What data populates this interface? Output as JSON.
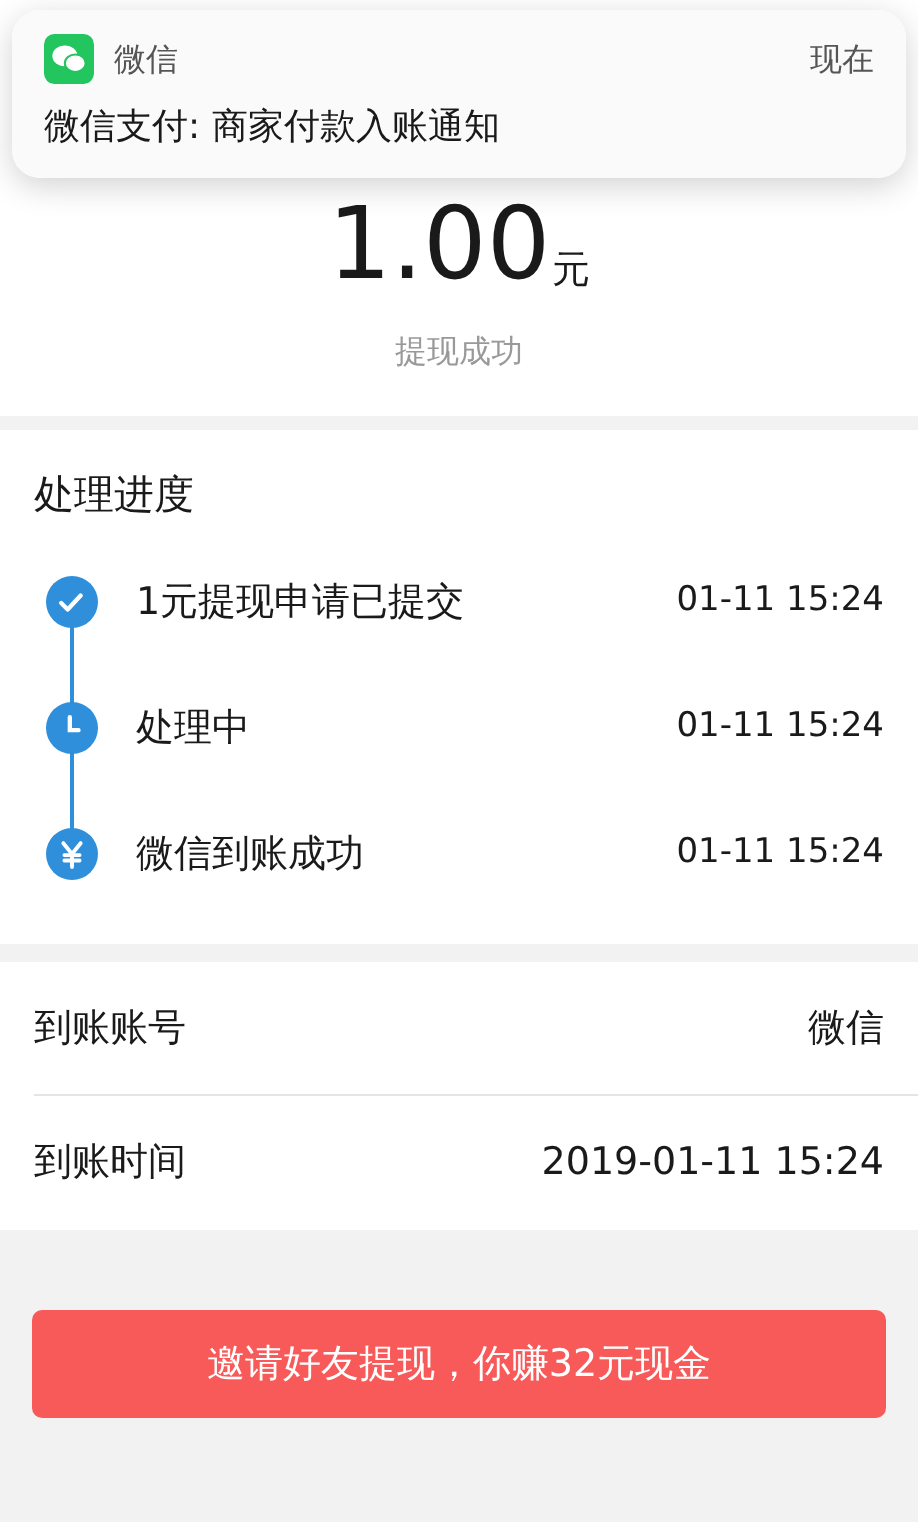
{
  "notification": {
    "app": "微信",
    "time": "现在",
    "message": "微信支付: 商家付款入账通知"
  },
  "amount": {
    "value": "1.00",
    "unit": "元",
    "status": "提现成功"
  },
  "progress": {
    "title": "处理进度",
    "steps": [
      {
        "kind": "check",
        "label": "1元提现申请已提交",
        "time": "01-11 15:24"
      },
      {
        "kind": "clock",
        "label": "处理中",
        "time": "01-11 15:24"
      },
      {
        "kind": "yen",
        "label": "微信到账成功",
        "time": "01-11 15:24"
      }
    ]
  },
  "details": [
    {
      "label": "到账账号",
      "value": "微信"
    },
    {
      "label": "到账时间",
      "value": "2019-01-11 15:24"
    }
  ],
  "invite_button": "邀请好友提现，你赚32元现金"
}
